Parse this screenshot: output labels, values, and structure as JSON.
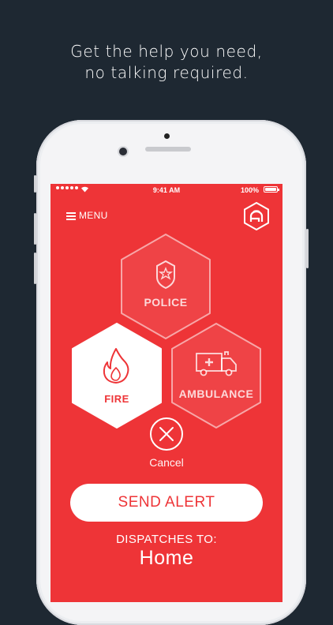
{
  "tagline": {
    "line1": "Get the help you need,",
    "line2": "no talking required."
  },
  "status_bar": {
    "time": "9:41 AM",
    "battery": "100%"
  },
  "header": {
    "menu_label": "MENU",
    "logo_icon": "app-logo-icon"
  },
  "services": {
    "police": {
      "label": "POLICE",
      "icon": "police-badge-icon",
      "selected": false
    },
    "fire": {
      "label": "FIRE",
      "icon": "flame-icon",
      "selected": true
    },
    "ambulance": {
      "label": "AMBULANCE",
      "icon": "ambulance-icon",
      "selected": false
    }
  },
  "cancel": {
    "label": "Cancel",
    "icon": "close-icon"
  },
  "send_alert": {
    "label": "SEND ALERT"
  },
  "dispatch": {
    "label": "DISPATCHES TO:",
    "value": "Home"
  },
  "colors": {
    "background": "#1e2832",
    "accent_red": "#ee3437",
    "white": "#ffffff"
  }
}
